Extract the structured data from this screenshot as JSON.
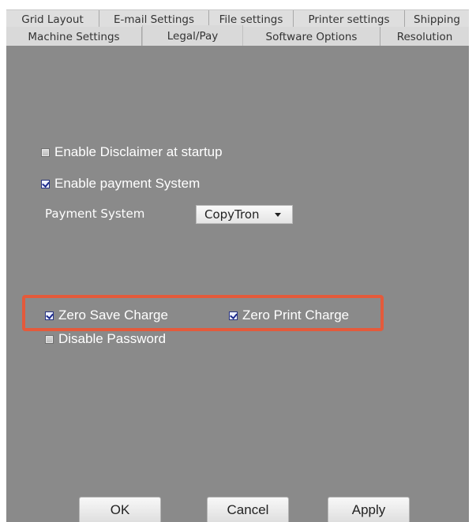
{
  "tabs": {
    "back_row": [
      "Grid Layout",
      "E-mail Settings",
      "File settings",
      "Printer settings",
      "Shipping"
    ],
    "front_row": [
      "Machine Settings",
      "Legal/Pay",
      "Software Options",
      "Resolution"
    ],
    "active": "Legal/Pay"
  },
  "legal_pay": {
    "enable_disclaimer": {
      "label": "Enable Disclaimer at startup",
      "checked": false
    },
    "enable_payment": {
      "label": "Enable payment System",
      "checked": true
    },
    "payment_system_label": "Payment System",
    "payment_system_value": "CopyTron",
    "zero_save_charge": {
      "label": "Zero Save Charge",
      "checked": true
    },
    "zero_print_charge": {
      "label": "Zero Print Charge",
      "checked": true
    },
    "disable_password": {
      "label": "Disable Password",
      "checked": false
    }
  },
  "buttons": {
    "ok": "OK",
    "cancel": "Cancel",
    "apply": "Apply"
  },
  "colors": {
    "panel_bg": "#8a8a8a",
    "highlight": "#e45a3b"
  }
}
